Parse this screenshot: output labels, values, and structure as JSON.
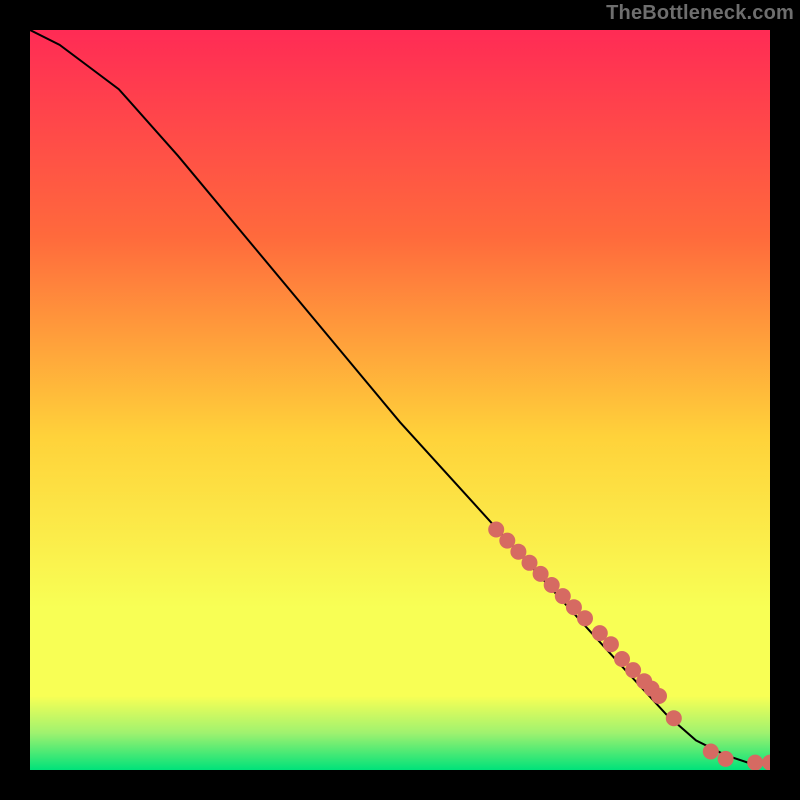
{
  "watermark": "TheBottleneck.com",
  "palette": {
    "grad_top": "#ff2b55",
    "grad_upper": "#ff6a3c",
    "grad_mid": "#ffd23a",
    "grad_lower": "#f8ff55",
    "grad_band": "#9ff26f",
    "grad_bottom": "#00e27a",
    "curve": "#000000",
    "dot": "#d66a62"
  },
  "chart_data": {
    "type": "line",
    "title": "",
    "xlabel": "",
    "ylabel": "",
    "xlim": [
      0,
      100
    ],
    "ylim": [
      0,
      100
    ],
    "series": [
      {
        "name": "bottleneck-curve",
        "x": [
          0,
          4,
          8,
          12,
          20,
          30,
          40,
          50,
          60,
          70,
          80,
          86,
          90,
          94,
          97,
          100
        ],
        "y": [
          100,
          98,
          95,
          92,
          83,
          71,
          59,
          47,
          36,
          25,
          14,
          7.5,
          4,
          2,
          1,
          1
        ]
      }
    ],
    "highlight_points": {
      "name": "sample-dots",
      "x": [
        63,
        64.5,
        66,
        67.5,
        69,
        70.5,
        72,
        73.5,
        75,
        77,
        78.5,
        80,
        81.5,
        83,
        84,
        85,
        87,
        92,
        94,
        98,
        100
      ],
      "y": [
        32.5,
        31,
        29.5,
        28,
        26.5,
        25,
        23.5,
        22,
        20.5,
        18.5,
        17,
        15,
        13.5,
        12,
        11,
        10,
        7,
        2.5,
        1.5,
        1,
        1
      ]
    }
  }
}
